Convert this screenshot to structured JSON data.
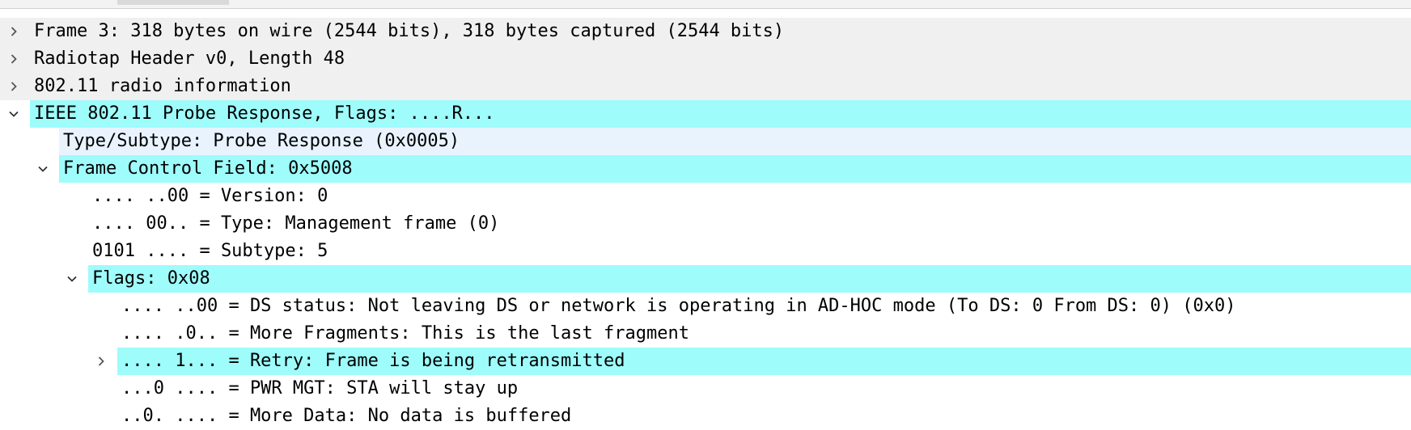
{
  "tree": [
    {
      "depth": 0,
      "expander": "collapsed",
      "bg": "gray",
      "text": "Frame 3: 318 bytes on wire (2544 bits), 318 bytes captured (2544 bits)"
    },
    {
      "depth": 0,
      "expander": "collapsed",
      "bg": "gray",
      "text": "Radiotap Header v0, Length 48"
    },
    {
      "depth": 0,
      "expander": "collapsed",
      "bg": "gray",
      "text": "802.11 radio information"
    },
    {
      "depth": 0,
      "expander": "expanded",
      "bg": "cyan",
      "text": "IEEE 802.11 Probe Response, Flags: ....R..."
    },
    {
      "depth": 1,
      "expander": "none",
      "bg": "pale",
      "text": "Type/Subtype: Probe Response (0x0005)"
    },
    {
      "depth": 1,
      "expander": "expanded",
      "bg": "cyan",
      "text": "Frame Control Field: 0x5008"
    },
    {
      "depth": 2,
      "expander": "none",
      "bg": "none",
      "text": ".... ..00 = Version: 0"
    },
    {
      "depth": 2,
      "expander": "none",
      "bg": "none",
      "text": ".... 00.. = Type: Management frame (0)"
    },
    {
      "depth": 2,
      "expander": "none",
      "bg": "none",
      "text": "0101 .... = Subtype: 5"
    },
    {
      "depth": 2,
      "expander": "expanded",
      "bg": "cyan",
      "text": "Flags: 0x08"
    },
    {
      "depth": 3,
      "expander": "none",
      "bg": "none",
      "text": ".... ..00 = DS status: Not leaving DS or network is operating in AD-HOC mode (To DS: 0 From DS: 0) (0x0)"
    },
    {
      "depth": 3,
      "expander": "none",
      "bg": "none",
      "text": ".... .0.. = More Fragments: This is the last fragment"
    },
    {
      "depth": 3,
      "expander": "collapsed",
      "bg": "cyan",
      "text": ".... 1... = Retry: Frame is being retransmitted"
    },
    {
      "depth": 3,
      "expander": "none",
      "bg": "none",
      "text": "...0 .... = PWR MGT: STA will stay up"
    },
    {
      "depth": 3,
      "expander": "none",
      "bg": "none",
      "text": "..0. .... = More Data: No data is buffered"
    }
  ]
}
